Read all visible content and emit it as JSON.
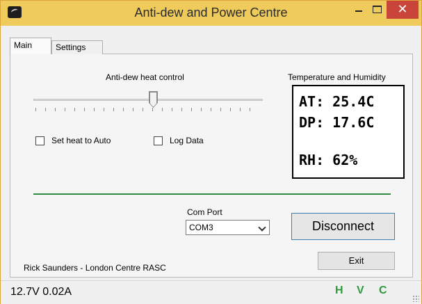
{
  "window": {
    "title": "Anti-dew and Power Centre",
    "close_glyph": "✕"
  },
  "tabs": [
    {
      "label": "Main"
    },
    {
      "label": "Settings"
    }
  ],
  "main": {
    "heat_control_label": "Anti-dew heat control",
    "heat_level": 0.5,
    "auto_heat_label": "Set heat to Auto",
    "log_data_label": "Log Data",
    "readout_title": "Temperature and Humidity",
    "readout": {
      "at": "AT: 25.4C",
      "dp": "DP: 17.6C",
      "rh": "RH: 62%"
    },
    "com_port_label": "Com Port",
    "com_port_value": "COM3",
    "disconnect_label": "Disconnect",
    "exit_label": "Exit",
    "credit": "Rick Saunders - London Centre RASC"
  },
  "status": {
    "power": "12.7V 0.02A",
    "flags": [
      "H",
      "V",
      "C"
    ],
    "flag_color": "#2e9a3e"
  },
  "colors": {
    "titlebar": "#eecb5a",
    "close": "#c9453a",
    "divider": "#2e8a3e"
  }
}
